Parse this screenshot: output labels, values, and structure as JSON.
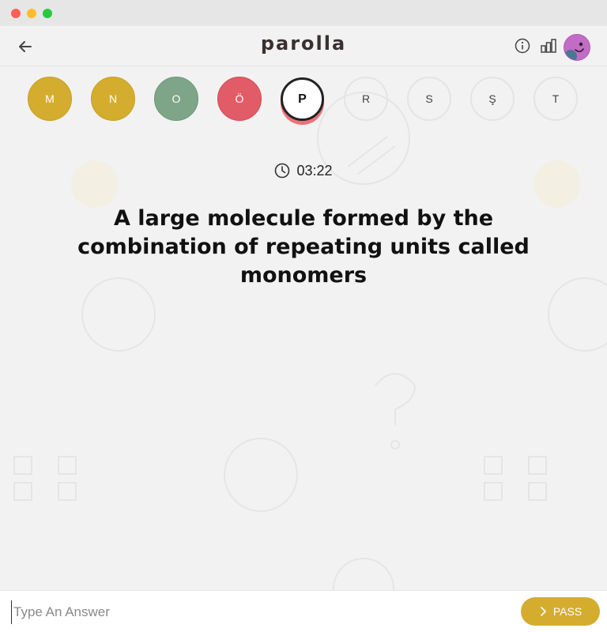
{
  "header": {
    "title": "parolla"
  },
  "letters": [
    {
      "label": "M",
      "state": "correct"
    },
    {
      "label": "N",
      "state": "correct"
    },
    {
      "label": "O",
      "state": "right"
    },
    {
      "label": "Ö",
      "state": "wrong"
    },
    {
      "label": "P",
      "state": "active"
    },
    {
      "label": "R",
      "state": "pending"
    },
    {
      "label": "S",
      "state": "pending"
    },
    {
      "label": "Ş",
      "state": "pending"
    },
    {
      "label": "T",
      "state": "pending"
    }
  ],
  "timer": {
    "value": "03:22"
  },
  "question": {
    "text": "A large molecule formed by the combination of repeating units called monomers"
  },
  "answer": {
    "placeholder": "Type An Answer",
    "value": "",
    "pass_label": "PASS"
  },
  "colors": {
    "yellow": "#d4ad2f",
    "green": "#7ea587",
    "red": "#e15c66",
    "active_ring": "#ee7279",
    "avatar": "#c36cc6"
  },
  "icons": {
    "back": "arrow-left-icon",
    "info": "info-icon",
    "stats": "bar-chart-icon",
    "timer": "clock-icon",
    "pass": "chevron-right-icon"
  }
}
